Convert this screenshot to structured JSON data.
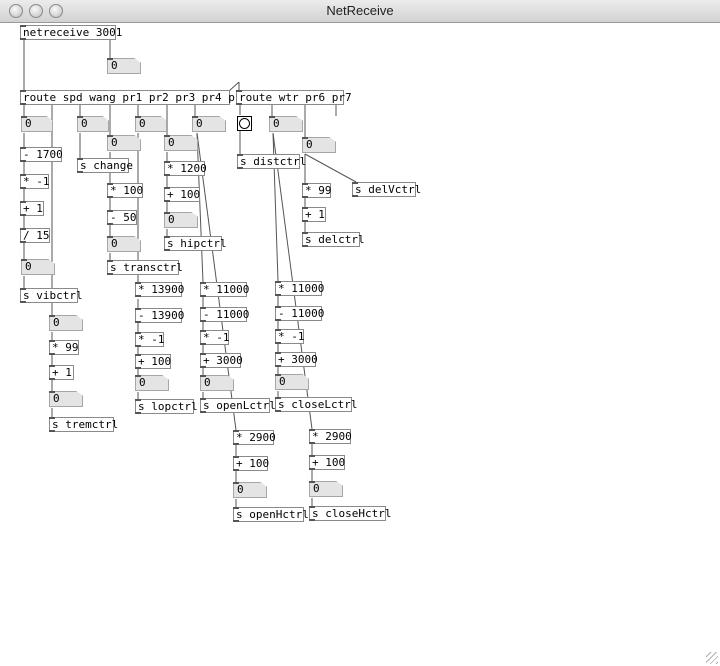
{
  "window": {
    "title": "NetReceive"
  },
  "objects": {
    "netreceive": "netreceive 3001",
    "route1": "route spd wang pr1 pr2 pr3 pr4 pr5",
    "route2": "route wtr pr6 pr7",
    "sub1700": "- 1700",
    "mul_neg1_a": "* -1",
    "add1_a": "+ 1",
    "div15": "/ 15",
    "s_vibctrl": "s vibctrl",
    "s_change": "s change",
    "mul100": "* 100",
    "sub50": "- 50",
    "s_transctrl": "s transctrl",
    "mul1200": "* 1200",
    "add100_a": "+ 100",
    "s_hipctrl": "s hipctrl",
    "s_distctrl": "s distctrl",
    "mul99_a": "* 99",
    "add1_b": "+ 1",
    "s_delctrl": "s delctrl",
    "s_delVctrl": "s delVctrl",
    "mul99_b": "* 99",
    "add1_c": "+ 1",
    "s_tremctrl": "s tremctrl",
    "mul13900": "* 13900",
    "sub13900": "- 13900",
    "mul_neg1_b": "* -1",
    "add100_b": "+ 100",
    "s_lopctrl": "s lopctrl",
    "mul11000_a": "* 11000",
    "sub11000_a": "- 11000",
    "mul_neg1_c": "* -1",
    "add3000_a": "+ 3000",
    "s_openLctrl": "s openLctrl",
    "mul11000_b": "* 11000",
    "sub11000_b": "- 11000",
    "mul_neg1_d": "* -1",
    "add3000_b": "+ 3000",
    "s_closeLctrl": "s closeLctrl",
    "mul2900_a": "* 2900",
    "add100_c": "+ 100",
    "s_openHctrl": "s openHctrl",
    "mul2900_b": "* 2900",
    "add100_d": "+ 100",
    "s_closeHctrl": "s closeHctrl"
  },
  "number_value": "0"
}
